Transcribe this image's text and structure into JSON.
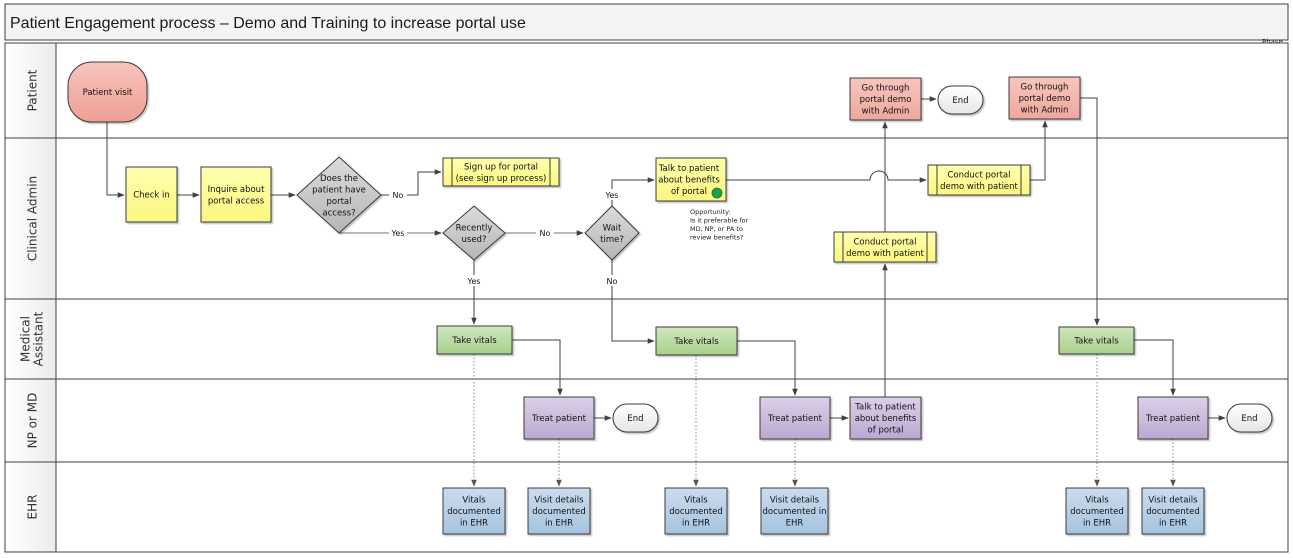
{
  "title": "Patient Engagement process – Demo and Training to increase portal use",
  "phase_label": "Phase",
  "colors": {
    "terminator_start": "#f2aaa0",
    "patient_box": "#f4b0a8",
    "admin_box": "#ffff99",
    "decision": "#c8c8c8",
    "vitals_box": "#b8d9a0",
    "treat_box": "#c9b9d9",
    "ehr_box": "#b4cde4",
    "end_fill": "#f8f8f8",
    "opportunity_dot": "#1aa34a",
    "line": "#404040"
  },
  "lanes": [
    {
      "id": "patient",
      "label": "Patient"
    },
    {
      "id": "admin",
      "label": "Clinical Admin"
    },
    {
      "id": "ma",
      "label": "Medical Assistant"
    },
    {
      "id": "md",
      "label": "NP or MD"
    },
    {
      "id": "ehr",
      "label": "EHR"
    }
  ],
  "nodes": [
    {
      "id": "patient_visit",
      "type": "terminator_start",
      "lane": "patient",
      "lines": [
        "Patient visit"
      ]
    },
    {
      "id": "check_in",
      "type": "process_admin",
      "lane": "admin",
      "lines": [
        "Check in"
      ]
    },
    {
      "id": "inquire",
      "type": "process_admin",
      "lane": "admin",
      "lines": [
        "Inquire about",
        "portal access"
      ]
    },
    {
      "id": "has_access",
      "type": "decision",
      "lane": "admin",
      "lines": [
        "Does the",
        "patient have",
        "portal",
        "access?"
      ]
    },
    {
      "id": "sign_up",
      "type": "subprocess_admin",
      "lane": "admin",
      "lines": [
        "Sign up for portal",
        "(see sign up process)"
      ]
    },
    {
      "id": "recently_used",
      "type": "decision",
      "lane": "admin",
      "lines": [
        "Recently",
        "used?"
      ]
    },
    {
      "id": "wait_time",
      "type": "decision",
      "lane": "admin",
      "lines": [
        "Wait",
        "time?"
      ]
    },
    {
      "id": "talk_admin",
      "type": "process_admin",
      "lane": "admin",
      "lines": [
        "Talk to patient",
        "about benefits",
        "of portal"
      ]
    },
    {
      "id": "conduct_demo_1",
      "type": "subprocess_admin",
      "lane": "admin",
      "lines": [
        "Conduct portal",
        "demo with patient"
      ]
    },
    {
      "id": "conduct_demo_2",
      "type": "subprocess_admin",
      "lane": "admin",
      "lines": [
        "Conduct portal",
        "demo with patient"
      ]
    },
    {
      "id": "go_demo_1",
      "type": "process_patient",
      "lane": "patient",
      "lines": [
        "Go through",
        "portal demo",
        "with Admin"
      ]
    },
    {
      "id": "end_1",
      "type": "end",
      "lane": "patient",
      "lines": [
        "End"
      ]
    },
    {
      "id": "go_demo_2",
      "type": "process_patient",
      "lane": "patient",
      "lines": [
        "Go through",
        "portal demo",
        "with Admin"
      ]
    },
    {
      "id": "vitals_1",
      "type": "process_vitals",
      "lane": "ma",
      "lines": [
        "Take vitals"
      ]
    },
    {
      "id": "vitals_2",
      "type": "process_vitals",
      "lane": "ma",
      "lines": [
        "Take vitals"
      ]
    },
    {
      "id": "vitals_3",
      "type": "process_vitals",
      "lane": "ma",
      "lines": [
        "Take vitals"
      ]
    },
    {
      "id": "treat_1",
      "type": "process_treat",
      "lane": "md",
      "lines": [
        "Treat patient"
      ]
    },
    {
      "id": "end_2",
      "type": "end",
      "lane": "md",
      "lines": [
        "End"
      ]
    },
    {
      "id": "treat_2",
      "type": "process_treat",
      "lane": "md",
      "lines": [
        "Treat patient"
      ]
    },
    {
      "id": "talk_md",
      "type": "process_treat",
      "lane": "md",
      "lines": [
        "Talk to patient",
        "about benefits",
        "of portal"
      ]
    },
    {
      "id": "treat_3",
      "type": "process_treat",
      "lane": "md",
      "lines": [
        "Treat patient"
      ]
    },
    {
      "id": "end_3",
      "type": "end",
      "lane": "md",
      "lines": [
        "End"
      ]
    },
    {
      "id": "ehr_vitals_1",
      "type": "process_ehr",
      "lane": "ehr",
      "lines": [
        "Vitals",
        "documented",
        "in EHR"
      ]
    },
    {
      "id": "ehr_visit_1",
      "type": "process_ehr",
      "lane": "ehr",
      "lines": [
        "Visit details",
        "documented",
        "in EHR"
      ]
    },
    {
      "id": "ehr_vitals_2",
      "type": "process_ehr",
      "lane": "ehr",
      "lines": [
        "Vitals",
        "documented",
        "in EHR"
      ]
    },
    {
      "id": "ehr_visit_2",
      "type": "process_ehr",
      "lane": "ehr",
      "lines": [
        "Visit details",
        "documented in",
        "EHR"
      ]
    },
    {
      "id": "ehr_vitals_3",
      "type": "process_ehr",
      "lane": "ehr",
      "lines": [
        "Vitals",
        "documented",
        "in EHR"
      ]
    },
    {
      "id": "ehr_visit_3",
      "type": "process_ehr",
      "lane": "ehr",
      "lines": [
        "Visit details",
        "documented",
        "in EHR"
      ]
    }
  ],
  "edges": [
    {
      "from": "patient_visit",
      "to": "check_in"
    },
    {
      "from": "check_in",
      "to": "inquire"
    },
    {
      "from": "inquire",
      "to": "has_access"
    },
    {
      "from": "has_access",
      "to": "sign_up",
      "label": "No"
    },
    {
      "from": "has_access",
      "to": "recently_used",
      "label": "Yes"
    },
    {
      "from": "recently_used",
      "to": "wait_time",
      "label": "No"
    },
    {
      "from": "recently_used",
      "to": "vitals_1",
      "label": "Yes"
    },
    {
      "from": "wait_time",
      "to": "talk_admin",
      "label": "Yes"
    },
    {
      "from": "wait_time",
      "to": "vitals_2",
      "label": "No"
    },
    {
      "from": "talk_admin",
      "to": "conduct_demo_2"
    },
    {
      "from": "conduct_demo_2",
      "to": "go_demo_2"
    },
    {
      "from": "go_demo_2",
      "to": "vitals_3"
    },
    {
      "from": "vitals_1",
      "to": "treat_1"
    },
    {
      "from": "treat_1",
      "to": "end_2"
    },
    {
      "from": "vitals_2",
      "to": "treat_2"
    },
    {
      "from": "treat_2",
      "to": "talk_md"
    },
    {
      "from": "talk_md",
      "to": "conduct_demo_1"
    },
    {
      "from": "conduct_demo_1",
      "to": "go_demo_1"
    },
    {
      "from": "go_demo_1",
      "to": "end_1"
    },
    {
      "from": "vitals_3",
      "to": "treat_3"
    },
    {
      "from": "treat_3",
      "to": "end_3"
    },
    {
      "from": "vitals_1",
      "to": "ehr_vitals_1",
      "style": "dotted"
    },
    {
      "from": "treat_1",
      "to": "ehr_visit_1",
      "style": "dotted"
    },
    {
      "from": "vitals_2",
      "to": "ehr_vitals_2",
      "style": "dotted"
    },
    {
      "from": "treat_2",
      "to": "ehr_visit_2",
      "style": "dotted"
    },
    {
      "from": "vitals_3",
      "to": "ehr_vitals_3",
      "style": "dotted"
    },
    {
      "from": "treat_3",
      "to": "ehr_visit_3",
      "style": "dotted"
    }
  ],
  "annotation": {
    "lines": [
      "Opportunity:",
      "Is it preferable for",
      "MD, NP, or PA to",
      "review benefits?"
    ],
    "marker": "green-circle"
  }
}
